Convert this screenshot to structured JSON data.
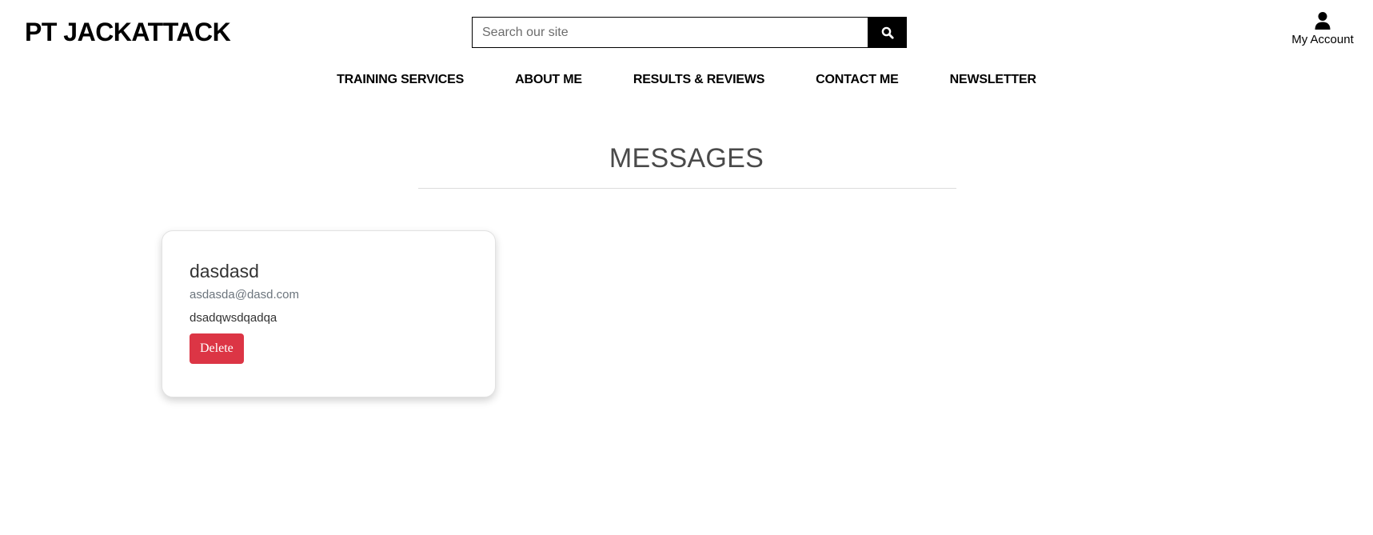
{
  "header": {
    "brand": "PT JACKATTACK",
    "search": {
      "placeholder": "Search our site",
      "value": "",
      "button_icon": "search-icon"
    },
    "account": {
      "icon": "user-icon",
      "label": "My Account"
    }
  },
  "nav": {
    "items": [
      {
        "label": "TRAINING SERVICES"
      },
      {
        "label": "ABOUT ME"
      },
      {
        "label": "RESULTS & REVIEWS"
      },
      {
        "label": "CONTACT ME"
      },
      {
        "label": "NEWSLETTER"
      }
    ]
  },
  "main": {
    "title": "MESSAGES",
    "messages": [
      {
        "name": "dasdasd",
        "email": "asdasda@dasd.com",
        "body": "dsadqwsdqadqa",
        "delete_label": "Delete"
      }
    ]
  },
  "colors": {
    "danger": "#dc3545",
    "muted": "#6c757d",
    "heading": "#4a4a4a"
  }
}
